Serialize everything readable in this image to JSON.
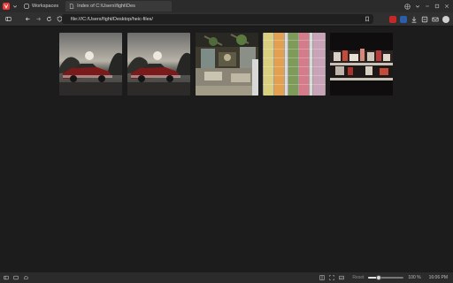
{
  "tabs": [
    {
      "label": "Workspaces",
      "icon": "workspaces-icon",
      "active": false
    },
    {
      "label": "Index of C:\\Users\\fight\\Des",
      "icon": "file-icon",
      "active": true
    }
  ],
  "address": {
    "url": "file:///C:/Users/fight/Desktop/heic-files/"
  },
  "images": [
    {
      "name": "car-sunset-1",
      "alt": "red car at sunset"
    },
    {
      "name": "car-sunset-2",
      "alt": "red car at sunset"
    },
    {
      "name": "cafe-interior",
      "alt": "cafe interior with plants"
    },
    {
      "name": "thread-spools",
      "alt": "colored thread spools"
    },
    {
      "name": "shelf-items",
      "alt": "shelf with items"
    }
  ],
  "status": {
    "reset_label": "Reset",
    "zoom": "100 %",
    "zoom_fraction": 0.3,
    "time": "16:06 PM"
  },
  "colors": {
    "brand": "#ef3939",
    "background": "#1c1c1c"
  }
}
